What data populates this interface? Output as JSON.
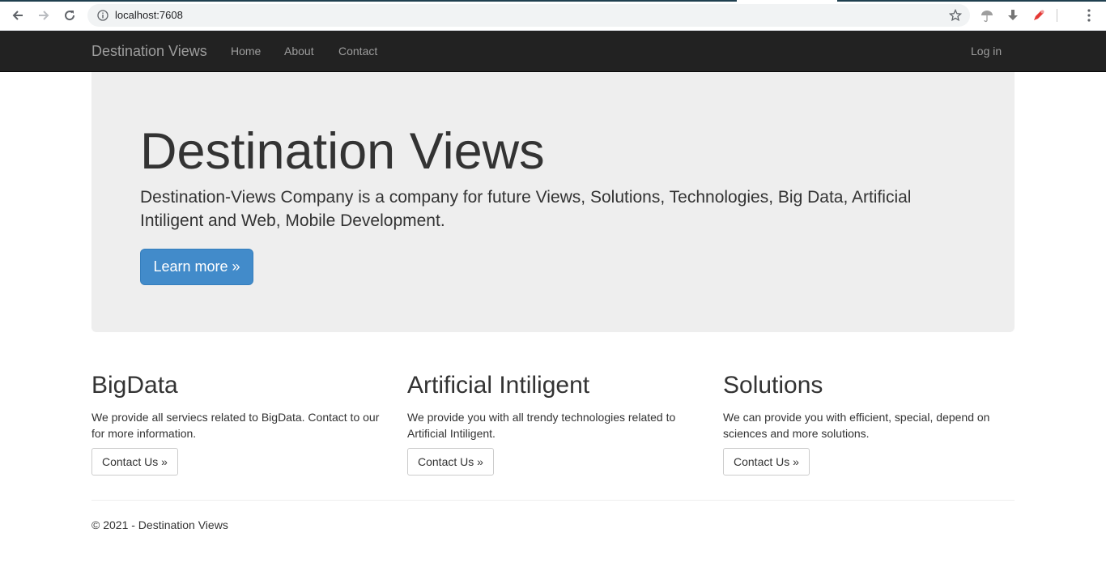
{
  "browser": {
    "url": "localhost:7608"
  },
  "navbar": {
    "brand": "Destination Views",
    "links": [
      "Home",
      "About",
      "Contact"
    ],
    "login": "Log in"
  },
  "jumbotron": {
    "title": "Destination Views",
    "lead": "Destination-Views Company is a company for future Views, Solutions, Technologies, Big Data, Artificial Intiligent and Web, Mobile Development.",
    "button": "Learn more »"
  },
  "columns": [
    {
      "title": "BigData",
      "text": "We provide all serviecs related to BigData. Contact to our for more information.",
      "button": "Contact Us »"
    },
    {
      "title": "Artificial Intiligent",
      "text": "We provide you with all trendy technologies related to Artificial Intiligent.",
      "button": "Contact Us »"
    },
    {
      "title": "Solutions",
      "text": "We can provide you with efficient, special, depend on sciences and more solutions.",
      "button": "Contact Us »"
    }
  ],
  "footer": {
    "text": "© 2021 - Destination Views"
  },
  "colors": {
    "navbar_bg": "#222222",
    "nav_text": "#9d9d9d",
    "jumbotron_bg": "#eeeeee",
    "primary": "#428bca",
    "extension_red": "#e53935"
  }
}
